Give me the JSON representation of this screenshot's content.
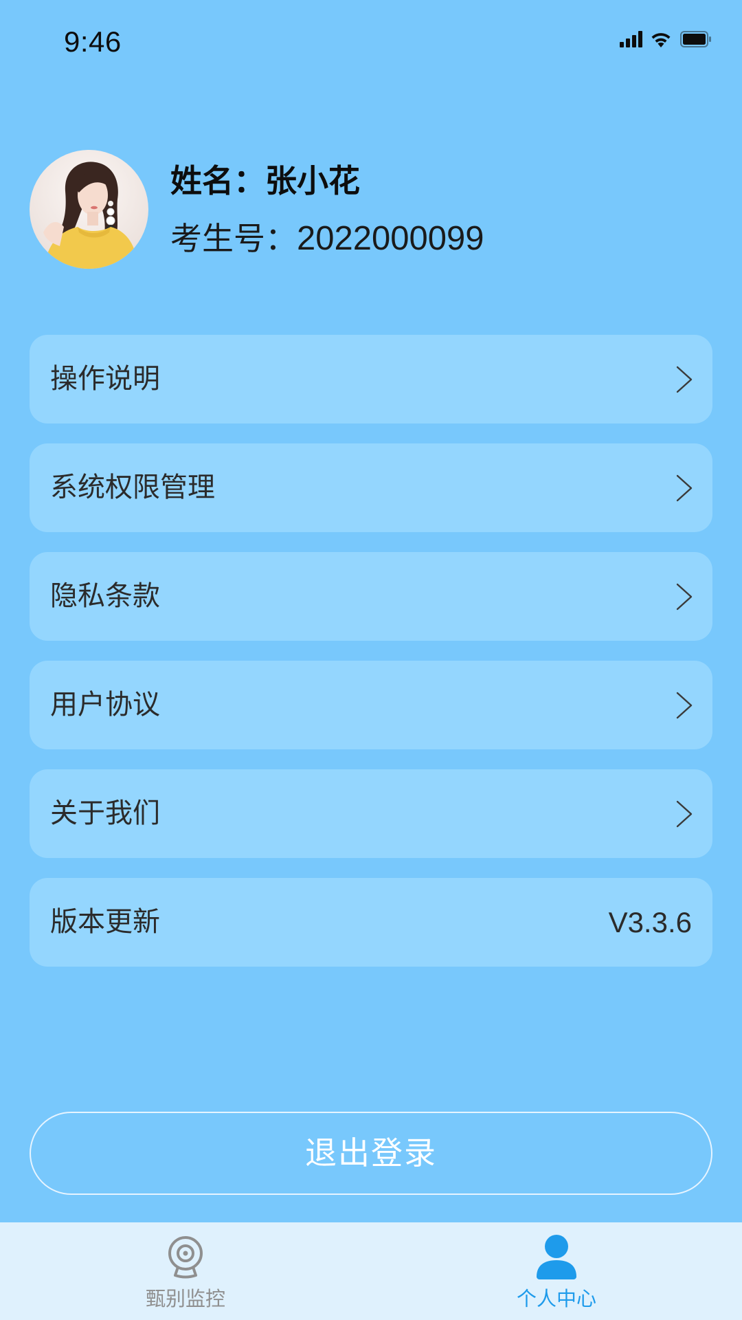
{
  "status_bar": {
    "time": "9:46"
  },
  "profile": {
    "name_label": "姓名：",
    "name": "张小花",
    "id_label": "考生号：",
    "id": "2022000099"
  },
  "menu": {
    "items": [
      {
        "label": "操作说明",
        "icon": "chevron-right-icon"
      },
      {
        "label": "系统权限管理",
        "icon": "chevron-right-icon"
      },
      {
        "label": "隐私条款",
        "icon": "chevron-right-icon"
      },
      {
        "label": "用户协议",
        "icon": "chevron-right-icon"
      },
      {
        "label": "关于我们",
        "icon": "chevron-right-icon"
      },
      {
        "label": "版本更新",
        "value": "V3.3.6"
      }
    ]
  },
  "logout": {
    "label": "退出登录"
  },
  "tab_bar": {
    "tabs": [
      {
        "label": "甄别监控",
        "icon": "webcam-icon",
        "active": false
      },
      {
        "label": "个人中心",
        "icon": "user-icon",
        "active": true
      }
    ]
  },
  "colors": {
    "background": "#78C8FC",
    "card": "#94D6FE",
    "tab_bar": "#DFF1FD",
    "active_tab": "#1E9BEB",
    "inactive_tab": "#8F8F8F"
  }
}
